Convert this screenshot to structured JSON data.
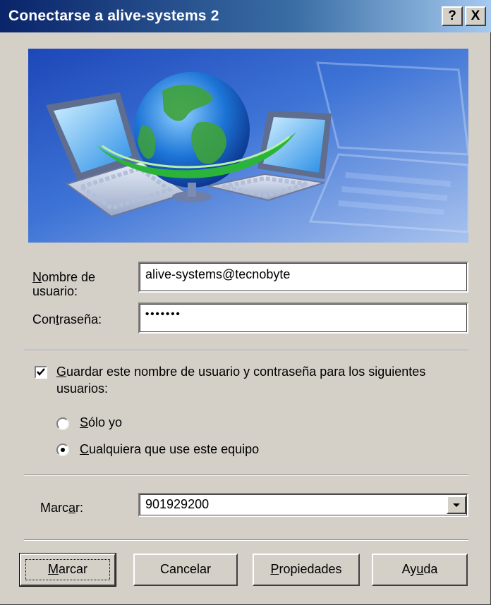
{
  "window": {
    "title": "Conectarse a alive-systems 2",
    "help_label": "?",
    "close_label": "X"
  },
  "form": {
    "username_label_access": "N",
    "username_label_rest": "ombre de usuario:",
    "username_value": "alive-systems@tecnobyte",
    "password_label_pre": "Con",
    "password_label_access": "t",
    "password_label_rest": "raseña:",
    "password_value": "•••••••"
  },
  "save_options": {
    "checkbox_checked": true,
    "checkbox_label_access": "G",
    "checkbox_label_rest": "uardar este nombre de usuario y contraseña para los siguientes usuarios:",
    "radio_only_me_access": "S",
    "radio_only_me_rest": "ólo yo",
    "radio_anyone_access": "C",
    "radio_anyone_rest": "ualquiera que use este equipo",
    "selected": "anyone"
  },
  "dial": {
    "label_pre": "Marc",
    "label_access": "a",
    "label_rest": "r:",
    "value": "901929200"
  },
  "buttons": {
    "dial_pre": "",
    "dial_access": "M",
    "dial_rest": "arcar",
    "cancel": "Cancelar",
    "properties_access": "P",
    "properties_rest": "ropiedades",
    "help_pre": "Ay",
    "help_access": "u",
    "help_rest": "da"
  },
  "colors": {
    "dialog_bg": "#d4d0c8",
    "title_gradient_start": "#0a246a",
    "title_gradient_end": "#a6caf0",
    "banner_blue": "#2d5fc8"
  }
}
